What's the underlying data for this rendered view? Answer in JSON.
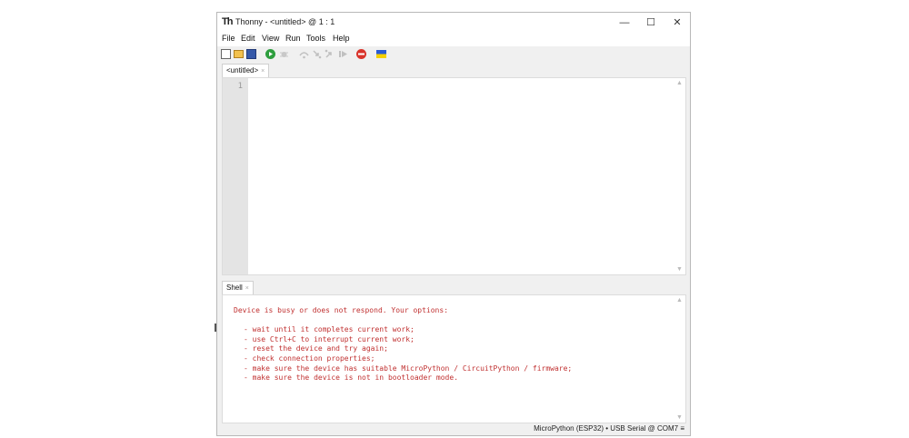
{
  "window": {
    "logo": "Th",
    "title": "Thonny  -  <untitled>  @  1 : 1",
    "controls": {
      "minimize": "—",
      "maximize": "☐",
      "close": "✕"
    }
  },
  "menu": [
    "File",
    "Edit",
    "View",
    "Run",
    "Tools",
    "Help"
  ],
  "toolbar": {
    "icons": [
      "new-file-icon",
      "open-file-icon",
      "save-icon",
      "run-icon",
      "debug-icon",
      "step-over-icon",
      "step-into-icon",
      "step-out-icon",
      "resume-icon",
      "stop-icon",
      "flag-icon"
    ],
    "colors": {
      "run": "#2e9e3e",
      "stop": "#d9342b",
      "flag_top": "#2a5bd7",
      "flag_bottom": "#f5d000"
    }
  },
  "editor": {
    "tab_label": "<untitled>",
    "tab_close": "×",
    "line_numbers": [
      "1"
    ]
  },
  "shell": {
    "tab_label": "Shell",
    "tab_close": "×",
    "message": "Device is busy or does not respond. Your options:",
    "options": [
      "- wait until it completes current work;",
      "- use Ctrl+C to interrupt current work;",
      "- reset the device and try again;",
      "- check connection properties;",
      "- make sure the device has suitable MicroPython / CircuitPython / firmware;",
      "- make sure the device is not in bootloader mode."
    ],
    "text_color": "#c03030"
  },
  "status": {
    "interpreter": "MicroPython (ESP32)  •  USB Serial @ COM7  ≡"
  }
}
